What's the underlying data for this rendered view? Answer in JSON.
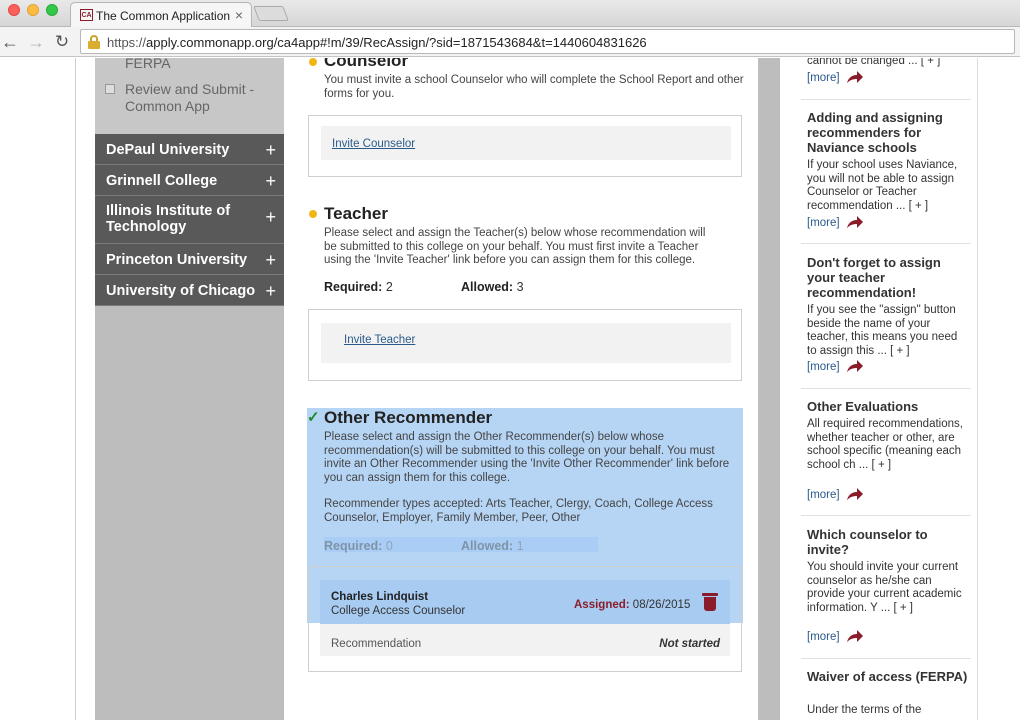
{
  "browser": {
    "tab_title": "The Common Application",
    "tab_favicon": "CA",
    "tab_close": "×",
    "url_scheme": "https://",
    "url_rest": "apply.commonapp.org/ca4app#!m/39/RecAssign/?sid=1871543684&t=1440604831626"
  },
  "sidebar": {
    "ferpa_label": "FERPA",
    "review_label": "Review and Submit - Common App",
    "colleges": [
      {
        "name": "DePaul University",
        "toggle": "+"
      },
      {
        "name": "Grinnell College",
        "toggle": "+"
      },
      {
        "name": "Illinois Institute of Technology",
        "toggle": "+"
      },
      {
        "name": "Princeton University",
        "toggle": "+"
      },
      {
        "name": "University of Chicago",
        "toggle": "+"
      }
    ]
  },
  "counselor": {
    "title": "Counselor",
    "description": "You must invite a school Counselor who will complete the School Report and other forms for you.",
    "invite_link": "Invite Counselor"
  },
  "teacher": {
    "title": "Teacher",
    "description": "Please select and assign the Teacher(s) below whose recommendation will be submitted to this college on your behalf. You must first invite a Teacher using the 'Invite Teacher' link before you can assign them for this college.",
    "required_label": "Required:",
    "required_value": "2",
    "allowed_label": "Allowed:",
    "allowed_value": "3",
    "invite_link": "Invite Teacher"
  },
  "other": {
    "check": "✓",
    "title": "Other Recommender",
    "description": "Please select and assign the Other Recommender(s) below whose recommendation(s) will be submitted to this college on your behalf. You must invite an Other Recommender using the 'Invite Other Recommender' link before you can assign them for this college.",
    "types": "Recommender types accepted: Arts Teacher, Clergy, Coach, College Access Counselor, Employer, Family Member, Peer, Other",
    "required_label": "Required:",
    "required_value": "0",
    "allowed_label": "Allowed:",
    "allowed_value": "1",
    "recommender": {
      "name": "Charles Lindquist",
      "type": "College Access Counselor",
      "assigned_label": "Assigned:",
      "assigned_date": "08/26/2015",
      "document": "Recommendation",
      "status": "Not started"
    }
  },
  "tips": {
    "top_snippet": "cannot be changed ... [ + ]",
    "more_label": "[more]",
    "items": [
      {
        "title": "Adding and assigning recommenders for Naviance schools",
        "body": "If your school uses Naviance, you will not be able to assign Counselor or Teacher recommendation ... [ + ]"
      },
      {
        "title": "Don't forget to assign your teacher recommendation!",
        "body": "If you see the \"assign\" button beside the name of your teacher, this means you need to assign this ... [ + ]"
      },
      {
        "title": "Other Evaluations",
        "body": "All required recommendations, whether teacher or other, are school specific (meaning each school ch ... [ + ]"
      },
      {
        "title": "Which counselor to invite?",
        "body": "You should invite your current counselor as he/she can provide your current academic information. Y ... [ + ]"
      },
      {
        "title": "Waiver of access (FERPA)",
        "body": "Under the terms of the"
      }
    ]
  },
  "colors": {
    "accent": "#8a1c2b",
    "sidebar_dark": "#595959",
    "highlight": "#b6d5f5",
    "bullet": "#f2b515"
  }
}
